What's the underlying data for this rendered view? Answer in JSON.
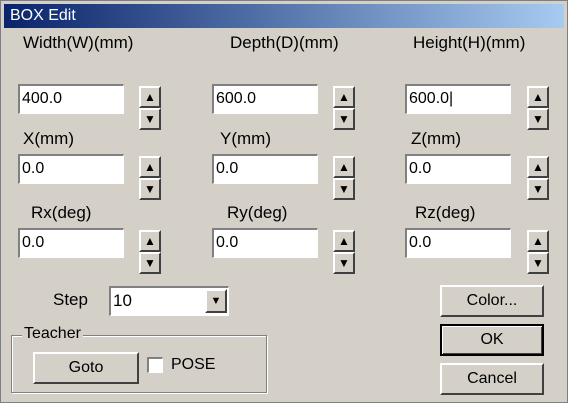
{
  "title": "BOX Edit",
  "fields": [
    {
      "label": "Width(W)(mm)",
      "value": "400.0"
    },
    {
      "label": "Depth(D)(mm)",
      "value": "600.0"
    },
    {
      "label": "Height(H)(mm)",
      "value": "600.0|"
    },
    {
      "label": "X(mm)",
      "value": "0.0"
    },
    {
      "label": "Y(mm)",
      "value": "0.0"
    },
    {
      "label": "Z(mm)",
      "value": "0.0"
    },
    {
      "label": "Rx(deg)",
      "value": "0.0"
    },
    {
      "label": "Ry(deg)",
      "value": "0.0"
    },
    {
      "label": "Rz(deg)",
      "value": "0.0"
    }
  ],
  "spin_icons": {
    "up": "▲",
    "down": "▼"
  },
  "step": {
    "label": "Step",
    "value": "10",
    "dropdown_icon": "▼"
  },
  "teacher": {
    "legend": "Teacher",
    "goto_label": "Goto",
    "pose_label": "POSE",
    "pose_checked": false
  },
  "buttons": {
    "color": "Color...",
    "ok": "OK",
    "cancel": "Cancel"
  }
}
